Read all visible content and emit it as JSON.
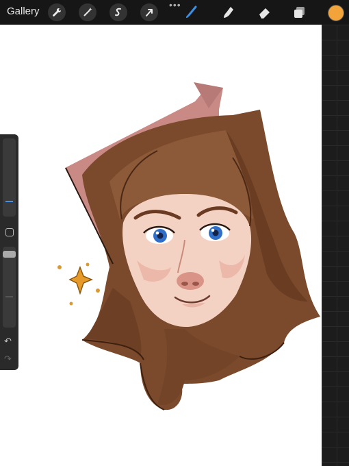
{
  "toolbar": {
    "gallery_label": "Gallery",
    "tools": [
      "wrench-icon",
      "magic-wand-icon",
      "selection-icon",
      "transform-arrow-icon",
      "brush-icon",
      "smudge-icon",
      "eraser-icon",
      "layers-icon"
    ],
    "more": "•••",
    "current_color": "#f2a43b",
    "active_tool_color": "#3d8fe6"
  },
  "sidebar": {
    "brush_size_fraction": 0.22,
    "opacity_fraction": 0.95,
    "undo_symbol": "↶",
    "redo_symbol": "↷"
  },
  "canvas": {
    "background": "#ffffff",
    "subject": "portrait-drawing"
  }
}
